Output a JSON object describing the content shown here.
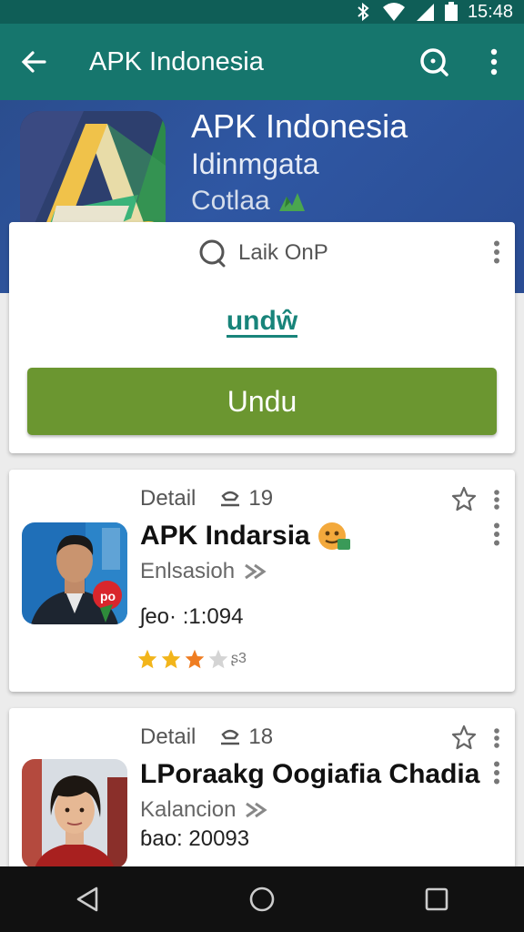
{
  "status_bar": {
    "time": "15:48",
    "icons": [
      "bluetooth-icon",
      "wifi-icon",
      "signal-icon",
      "battery-icon"
    ]
  },
  "app_bar": {
    "title": "APK Indonesia",
    "icons": [
      "back-arrow-icon",
      "search-icon",
      "more-vert-icon"
    ]
  },
  "hero": {
    "app_name": "APK Indonesia",
    "subtitle": "Idinmgata",
    "category": "Cotlaa"
  },
  "download_card": {
    "search_text": "Laik OnP",
    "brand_text": "undŵ",
    "button_label": "Undu"
  },
  "app_list": [
    {
      "section_label": "Detail",
      "count": "19",
      "name": "APK Indarsia",
      "category": "Enlsasioh",
      "version": "ʃeo· :1:094",
      "rating_stars": 3,
      "rating_text": "ʂ3"
    },
    {
      "section_label": "Detail",
      "count": "18",
      "name": "LPoraakg Oogiafia Chadia",
      "category": "Kalancion",
      "version": "ɓao: 20093",
      "rating_stars": 0,
      "rating_text": ""
    }
  ],
  "colors": {
    "primary": "#16766d",
    "status_bar": "#0f5e57",
    "hero_blue": "#2f57a3",
    "download_button": "#6b9630",
    "brand_teal": "#18847a",
    "star_gold": "#f2b51b"
  }
}
